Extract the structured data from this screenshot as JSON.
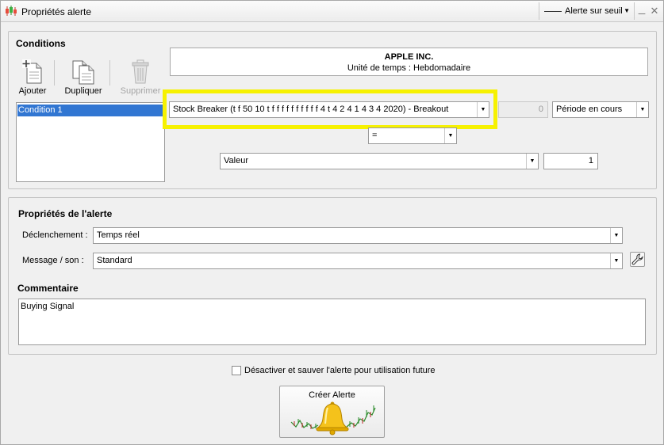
{
  "window": {
    "title": "Propriétés alerte",
    "alert_type": "Alerte sur seuil",
    "minimize_glyph": "_",
    "close_glyph": "✕"
  },
  "conditions": {
    "section_title": "Conditions",
    "toolbar": {
      "add_label": "Ajouter",
      "duplicate_label": "Dupliquer",
      "delete_label": "Supprimer"
    },
    "list": [
      "Condition 1"
    ],
    "instrument": {
      "name": "APPLE INC.",
      "timeframe": "Unité de temps : Hebdomadaire"
    },
    "indicator_select": "Stock Breaker (t f 50 10 t f f f f f f f f f f 4 t 4 2 4 1 4 3 4 2020) - Breakout",
    "offset_value": "0",
    "period_select": "Période en cours",
    "operator_select": "=",
    "compare_select": "Valeur",
    "compare_value": "1"
  },
  "alert_properties": {
    "section_title": "Propriétés de l'alerte",
    "trigger_label": "Déclenchement :",
    "trigger_select": "Temps réel",
    "message_label": "Message / son :",
    "message_select": "Standard",
    "comment_title": "Commentaire",
    "comment_value": "Buying Signal"
  },
  "footer": {
    "deactivate_label": "Désactiver et sauver l'alerte pour utilisation future",
    "deactivate_checked": false,
    "create_label": "Créer Alerte"
  },
  "colors": {
    "highlight": "#f6f100",
    "selection": "#3176d2"
  },
  "icons": {
    "app": "candlestick-chart-icon",
    "add": "add-document-icon",
    "duplicate": "duplicate-documents-icon",
    "delete": "trash-can-icon",
    "wrench": "wrench-icon",
    "bell": "golden-bell-icon"
  }
}
